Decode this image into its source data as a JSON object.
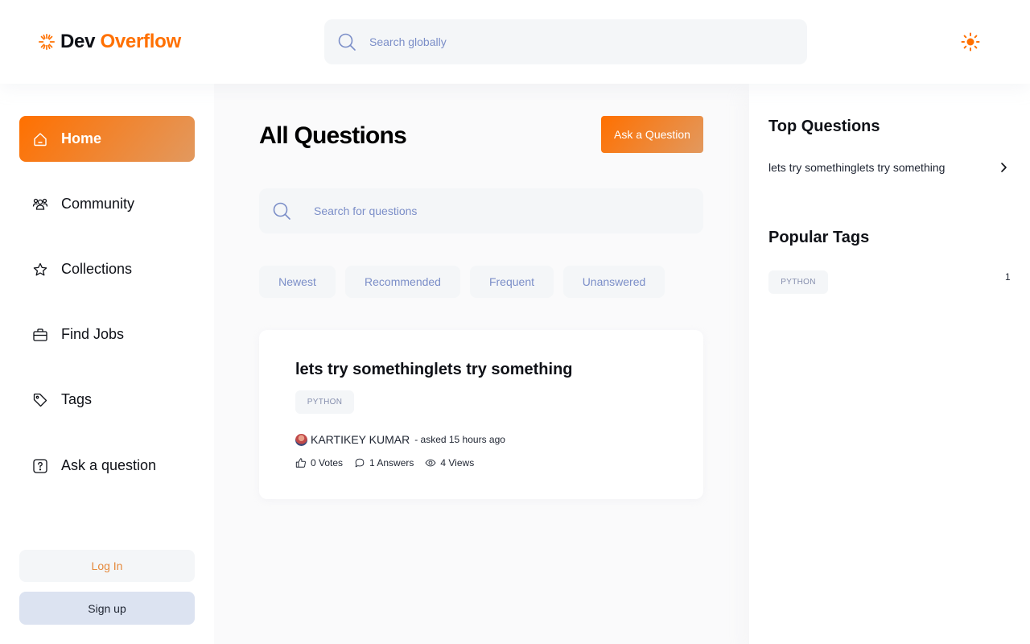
{
  "brand": {
    "part1": "Dev",
    "part2": "Overflow"
  },
  "global_search": {
    "placeholder": "Search globally"
  },
  "sidebar": {
    "items": [
      {
        "label": "Home",
        "icon": "home-icon",
        "active": true
      },
      {
        "label": "Community",
        "icon": "users-icon"
      },
      {
        "label": "Collections",
        "icon": "star-icon"
      },
      {
        "label": "Find Jobs",
        "icon": "briefcase-icon"
      },
      {
        "label": "Tags",
        "icon": "tag-icon"
      },
      {
        "label": "Ask a question",
        "icon": "question-icon"
      }
    ],
    "login_label": "Log In",
    "signup_label": "Sign up"
  },
  "main": {
    "title": "All Questions",
    "ask_button": "Ask a Question",
    "search_placeholder": "Search for questions",
    "filters": [
      "Newest",
      "Recommended",
      "Frequent",
      "Unanswered"
    ],
    "questions": [
      {
        "title": "lets try somethinglets try something",
        "tags": [
          "PYTHON"
        ],
        "author": "KARTIKEY KUMAR",
        "asked": "- asked 15 hours ago",
        "votes": "0 Votes",
        "answers": "1 Answers",
        "views": "4 Views"
      }
    ]
  },
  "rightbar": {
    "top_title": "Top Questions",
    "top_questions": [
      "lets try somethinglets try something"
    ],
    "tags_title": "Popular Tags",
    "popular_tags": [
      {
        "name": "PYTHON",
        "count": "1"
      }
    ]
  },
  "colors": {
    "accent": "#ff7000",
    "accent_light": "#e2995f",
    "text": "#0f1117",
    "muted": "#7b8ec8",
    "surface": "#f4f6f8"
  }
}
